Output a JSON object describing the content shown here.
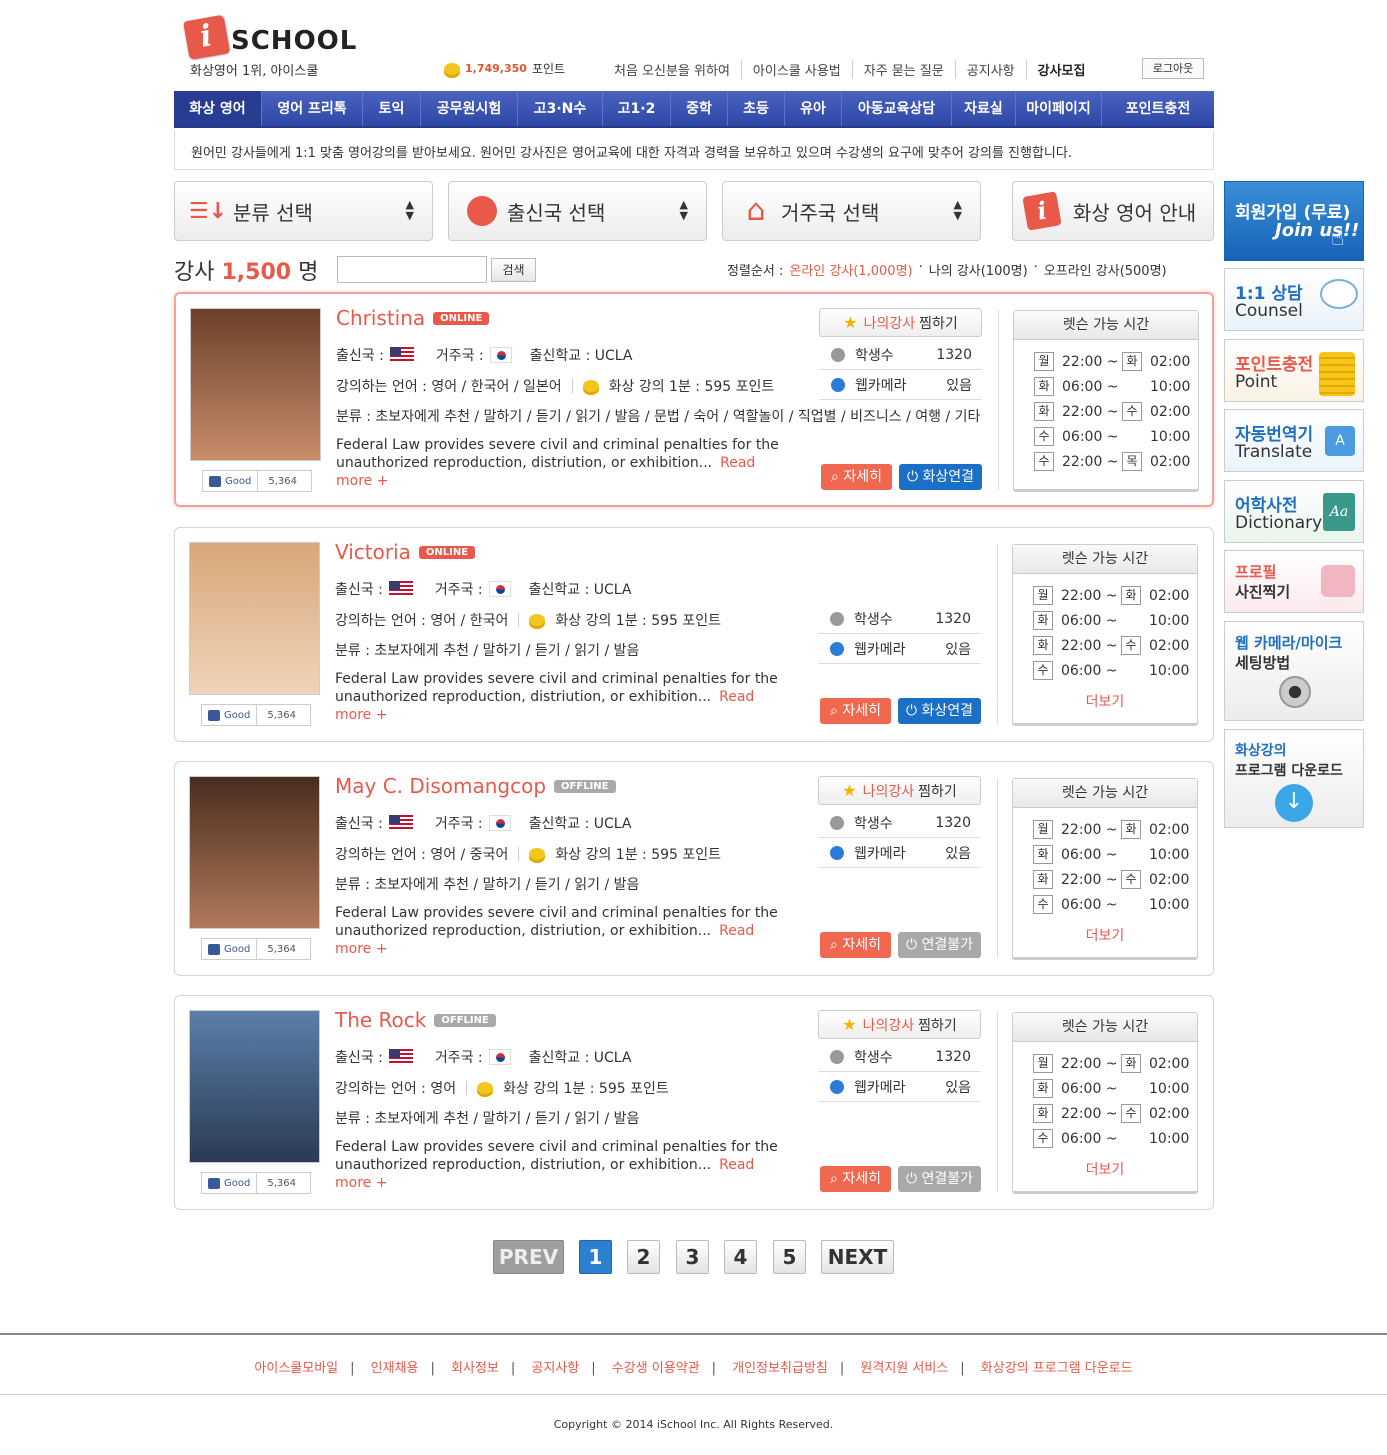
{
  "header": {
    "logo_letter": "i",
    "logo_text": "SCHOOL",
    "slogan": "화상영어 1위, 아이스쿨",
    "points_value": "1,749,350",
    "points_unit": "포인트",
    "top_links": [
      "처음 오신분을 위하여",
      "아이스쿨 사용법",
      "자주 묻는 질문",
      "공지사항",
      "강사모집"
    ],
    "logout": "로그아웃"
  },
  "nav": {
    "items": [
      "화상 영어",
      "영어 프리톡",
      "토익",
      "공무원시험",
      "고3·N수",
      "고1·2",
      "중학",
      "초등",
      "유아",
      "아동교육상담",
      "자료실",
      "마이페이지",
      "포인트충전"
    ]
  },
  "intro": "원어민 강사들에게 1:1 맞춤 영어강의를 받아보세요. 원어민 강사진은 영어교육에 대한 자격과 경력을 보유하고 있으며 수강생의 요구에 맞추어 강의를 진행합니다.",
  "selectors": {
    "category": "분류 선택",
    "origin": "출신국 선택",
    "residence": "거주국 선택",
    "guide": "화상 영어 안내"
  },
  "count": {
    "prefix": "강사",
    "value": "1,500",
    "suffix": "명"
  },
  "search": {
    "button": "검색",
    "placeholder": ""
  },
  "sort": {
    "label": "정렬순서 :",
    "online": "온라인 강사(1,000명)",
    "mine": "나의 강사(100명)",
    "offline": "오프라인 강사(500명)"
  },
  "labels": {
    "origin": "출신국 :",
    "residence": "거주국 :",
    "school": "출신학교 : UCLA",
    "fav_mine": "나의강사",
    "fav_rest": "찜하기",
    "students": "학생수",
    "webcam": "웹카메라",
    "detail": "자세히",
    "connect": "화상연결",
    "unavailable": "연결불가",
    "good": "Good",
    "schedule_title": "렛슨 가능 시간",
    "more": "더보기",
    "read_more": "Read more +",
    "desc_line1": "Federal Law provides severe civil and criminal penalties for the",
    "desc_line2": "unauthorized reproduction, distriution, or exhibition..."
  },
  "teachers": [
    {
      "name": "Christina",
      "status": "ONLINE",
      "languages": "강의하는 언어 : 영어 / 한국어 / 일본어",
      "price": "화상 강의 1분 : 595 포인트",
      "category": "분류 : 초보자에게 추천 / 말하기 / 듣기 / 읽기 / 발음 / 문법 / 숙어 / 역할놀이 / 직업별 / 비즈니스 / 여행 / 기타",
      "students": "1320",
      "webcam": "있음",
      "good_count": "5,364",
      "schedule": [
        [
          "월",
          "22:00 ~",
          "화",
          "02:00"
        ],
        [
          "화",
          "06:00 ~",
          "",
          "10:00"
        ],
        [
          "화",
          "22:00 ~",
          "수",
          "02:00"
        ],
        [
          "수",
          "06:00 ~",
          "",
          "10:00"
        ],
        [
          "수",
          "22:00 ~",
          "목",
          "02:00"
        ]
      ]
    },
    {
      "name": "Victoria",
      "status": "ONLINE",
      "languages": "강의하는 언어 : 영어 / 한국어",
      "price": "화상 강의 1분 : 595 포인트",
      "category": "분류 : 초보자에게 추천 / 말하기 / 듣기 / 읽기 / 발음",
      "students": "1320",
      "webcam": "있음",
      "good_count": "5,364",
      "schedule": [
        [
          "월",
          "22:00 ~",
          "화",
          "02:00"
        ],
        [
          "화",
          "06:00 ~",
          "",
          "10:00"
        ],
        [
          "화",
          "22:00 ~",
          "수",
          "02:00"
        ],
        [
          "수",
          "06:00 ~",
          "",
          "10:00"
        ]
      ]
    },
    {
      "name": "May C. Disomangcop",
      "status": "OFFLINE",
      "languages": "강의하는 언어 : 영어 / 중국어",
      "price": "화상 강의 1분 : 595 포인트",
      "category": "분류 : 초보자에게 추천 / 말하기 / 듣기 / 읽기 / 발음",
      "students": "1320",
      "webcam": "있음",
      "good_count": "5,364",
      "schedule": [
        [
          "월",
          "22:00 ~",
          "화",
          "02:00"
        ],
        [
          "화",
          "06:00 ~",
          "",
          "10:00"
        ],
        [
          "화",
          "22:00 ~",
          "수",
          "02:00"
        ],
        [
          "수",
          "06:00 ~",
          "",
          "10:00"
        ]
      ]
    },
    {
      "name": "The Rock",
      "status": "OFFLINE",
      "languages": "강의하는 언어 : 영어",
      "price": "화상 강의 1분 : 595 포인트",
      "category": "분류 : 초보자에게 추천 / 말하기 / 듣기 / 읽기 / 발음",
      "students": "1320",
      "webcam": "있음",
      "good_count": "5,364",
      "schedule": [
        [
          "월",
          "22:00 ~",
          "화",
          "02:00"
        ],
        [
          "화",
          "06:00 ~",
          "",
          "10:00"
        ],
        [
          "화",
          "22:00 ~",
          "수",
          "02:00"
        ],
        [
          "수",
          "06:00 ~",
          "",
          "10:00"
        ]
      ]
    }
  ],
  "sidebar": {
    "join_title": "회원가입 (무료)",
    "join_sub": "Join us!!",
    "counsel_title": "1:1 상담",
    "counsel_sub": "Counsel",
    "point_title": "포인트충전",
    "point_sub": "Point",
    "translate_title": "자동번역기",
    "translate_sub": "Translate",
    "dict_title": "어학사전",
    "dict_sub": "Dictionary",
    "photo_title": "프로필",
    "photo_sub": "사진찍기",
    "cam_title": "웹 카메라/마이크",
    "cam_sub": "세팅방법",
    "download_title": "화상강의",
    "download_sub": "프로그램 다운로드"
  },
  "pagination": {
    "prev": "PREV",
    "pages": [
      "1",
      "2",
      "3",
      "4",
      "5"
    ],
    "next": "NEXT"
  },
  "footer": {
    "links": [
      "아이스쿨모바일",
      "인재채용",
      "회사정보",
      "공지사항",
      "수강생 이용약관",
      "개인정보취급방침",
      "원격지원 서비스",
      "화상강의 프로그램 다운로드"
    ],
    "copyright": "Copyright © 2014 iSchool Inc. All Rights Reserved."
  },
  "colors": {
    "accent": "#e8594a",
    "nav": "#3a52b0",
    "connect": "#1b6fc7"
  }
}
